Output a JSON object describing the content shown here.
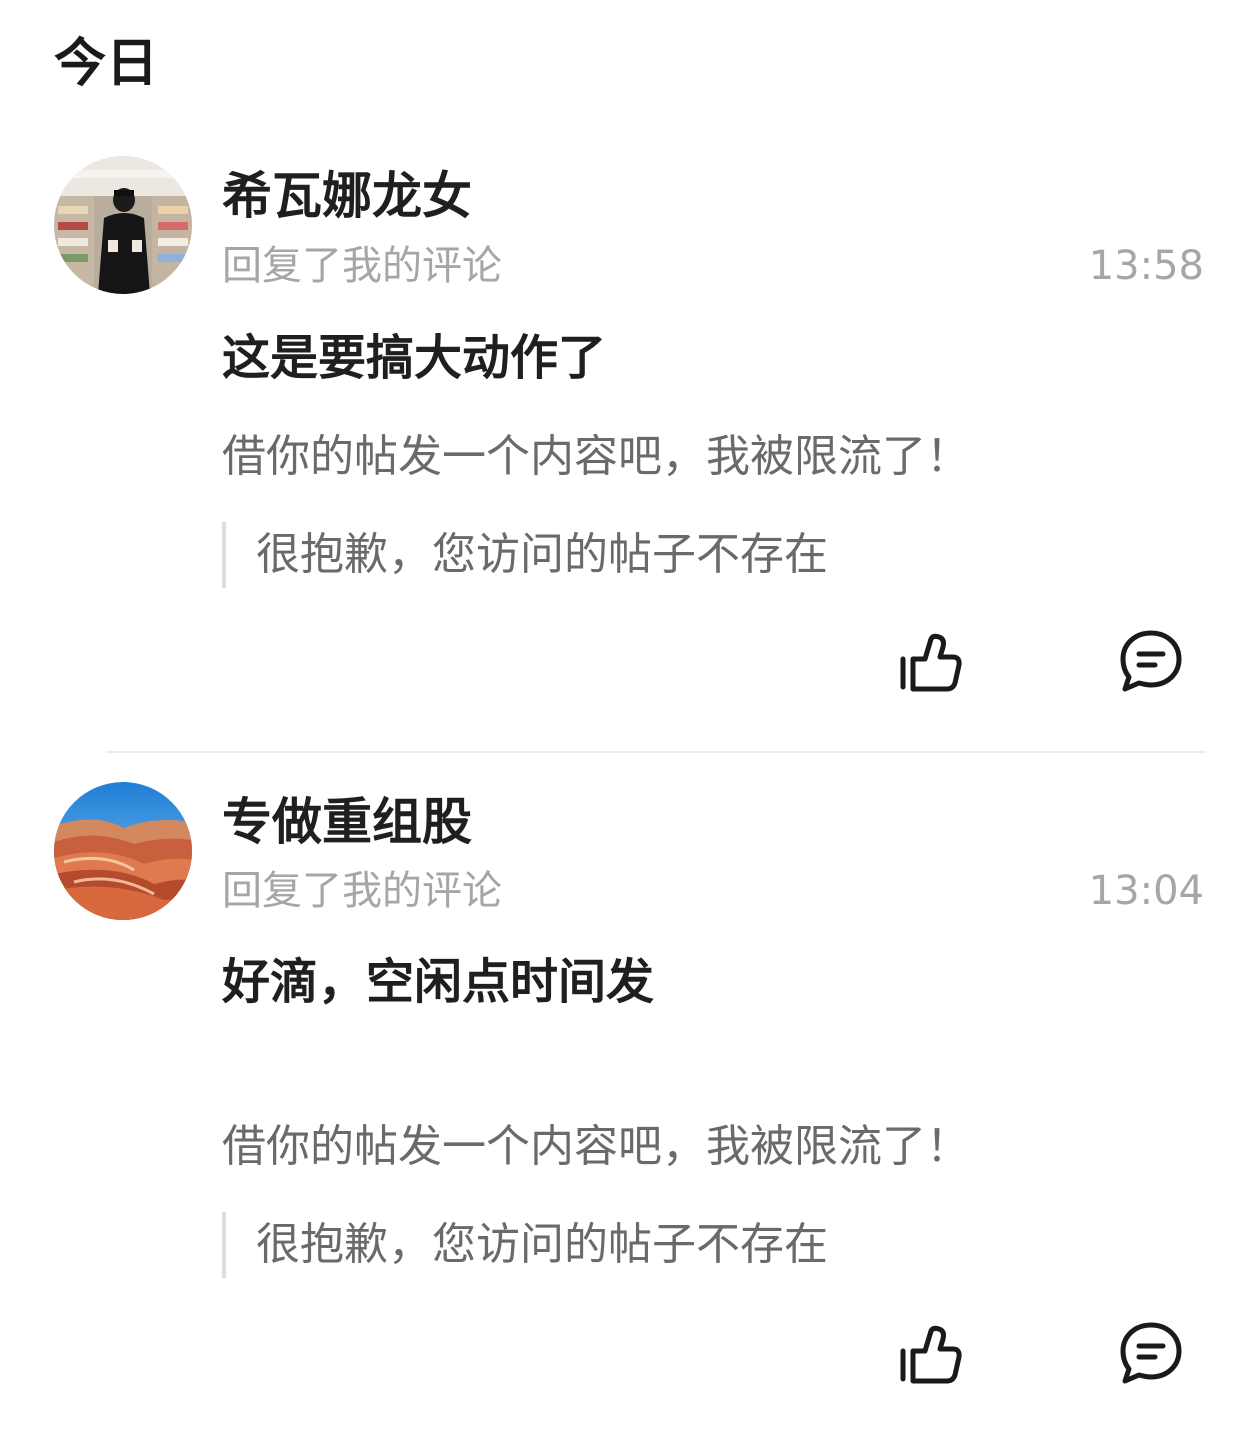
{
  "section": {
    "title": "今日"
  },
  "notifications": [
    {
      "username": "希瓦娜龙女",
      "action": "回复了我的评论",
      "time": "13:58",
      "reply": "这是要搞大动作了",
      "my_comment": "借你的帖发一个内容吧，我被限流了！",
      "quoted_post": "很抱歉，您访问的帖子不存在",
      "avatar_icon": "avatar-photo-person-in-store"
    },
    {
      "username": "专做重组股",
      "action": "回复了我的评论",
      "time": "13:04",
      "reply": "好滴，空闲点时间发",
      "my_comment": "借你的帖发一个内容吧，我被限流了！",
      "quoted_post": "很抱歉，您访问的帖子不存在",
      "avatar_icon": "avatar-photo-red-rock-landscape"
    }
  ],
  "icons": {
    "like": "thumbs-up-icon",
    "reply": "comment-bubble-icon"
  },
  "colors": {
    "primary_text": "#1f1f1f",
    "secondary_text": "#a6a6a6",
    "comment_text": "#6a6a6a",
    "divider": "#ececec"
  }
}
